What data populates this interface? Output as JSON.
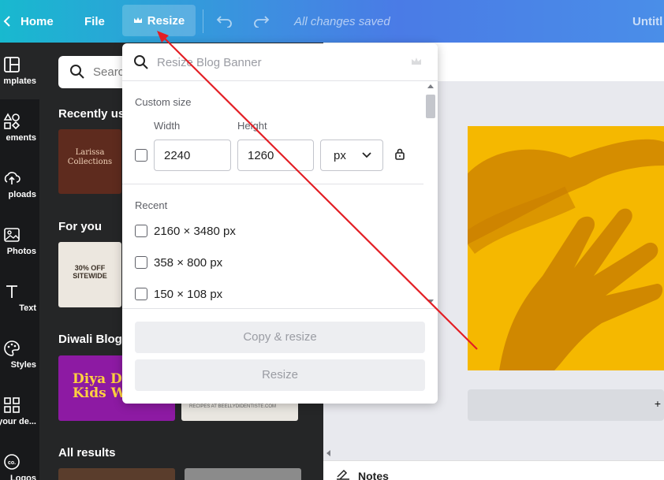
{
  "topbar": {
    "home": "Home",
    "file": "File",
    "resize": "Resize",
    "saved_status": "All changes saved",
    "doc_title": "Untitl"
  },
  "rail": [
    {
      "label": "mplates",
      "icon": "templates-icon"
    },
    {
      "label": "ements",
      "icon": "elements-icon"
    },
    {
      "label": "ploads",
      "icon": "uploads-icon"
    },
    {
      "label": "Photos",
      "icon": "photos-icon"
    },
    {
      "label": "Text",
      "icon": "text-icon"
    },
    {
      "label": "Styles",
      "icon": "styles-icon"
    },
    {
      "label": "your de...",
      "icon": "your-designs-icon"
    },
    {
      "label": "Logos",
      "icon": "logos-icon"
    }
  ],
  "panel": {
    "search_placeholder": "Searc",
    "sections": {
      "recently_used": "Recently use",
      "for_you": "For you",
      "diwali": "Diwali Blog B",
      "all_results": "All results"
    },
    "thumbs": {
      "larissa": "Larissa Collections",
      "sale_top": "30% OFF SITEWIDE",
      "diwali_purple": "Diya Deco Kids Wi",
      "diwali_light": "RECIPES AT BEELLYDIDENTISTE.COM"
    }
  },
  "dropdown": {
    "search_placeholder": "Resize Blog Banner",
    "custom_size_label": "Custom size",
    "width_label": "Width",
    "height_label": "Height",
    "width_value": "2240",
    "height_value": "1260",
    "unit": "px",
    "recent_label": "Recent",
    "recent_items": [
      "2160 × 3480 px",
      "358 × 800 px",
      "150 × 108 px"
    ],
    "copy_resize_label": "Copy & resize",
    "resize_label": "Resize"
  },
  "canvas": {
    "add_page": "+",
    "notes_label": "Notes"
  },
  "colors": {
    "annotation_arrow": "#e31e24",
    "design_background": "#f5b800"
  }
}
